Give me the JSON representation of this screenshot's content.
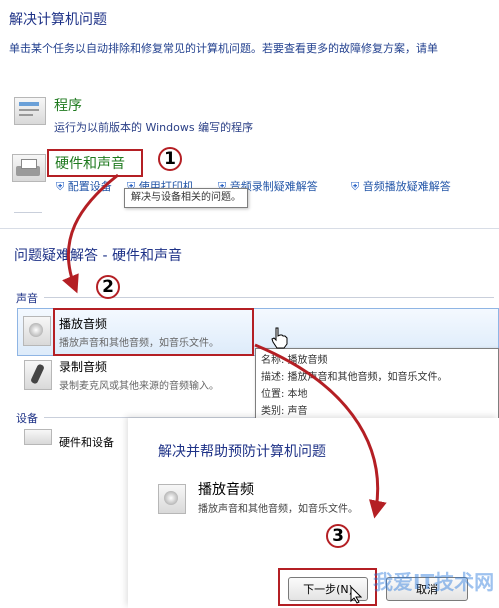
{
  "top": {
    "title": "解决计算机问题",
    "description": "单击某个任务以自动排除和修复常见的计算机问题。若要查看更多的故障修复方案，请单",
    "programs": {
      "title": "程序",
      "desc": "运行为以前版本的 Windows 编写的程序"
    },
    "hardware": {
      "title": "硬件和声音",
      "links": [
        "配置设备",
        "使用打印机",
        "音频录制疑难解答",
        "音频播放疑难解答"
      ]
    },
    "tooltip": "解决与设备相关的问题。"
  },
  "middle": {
    "title": "问题疑难解答 - 硬件和声音",
    "section_sound": "声音",
    "section_device": "设备",
    "items": [
      {
        "title": "播放音频",
        "desc": "播放声音和其他音频，如音乐文件。"
      },
      {
        "title": "录制音频",
        "desc": "录制麦克风或其他来源的音频输入。"
      },
      {
        "title": "硬件和设备",
        "desc": ""
      }
    ],
    "tooltip": {
      "name": "名称: 播放音频",
      "desc": "描述: 播放声音和其他音频，如音乐文件。",
      "location": "位置: 本地",
      "category": "类别: 声音"
    }
  },
  "bottom": {
    "title": "解决并帮助预防计算机问题",
    "item_title": "播放音频",
    "item_desc": "播放声音和其他音频，如音乐文件。",
    "next_button": "下一步(N)",
    "cancel_button": "取消"
  },
  "callouts": [
    "1",
    "2",
    "3"
  ],
  "watermark": "我爱IT技术网"
}
